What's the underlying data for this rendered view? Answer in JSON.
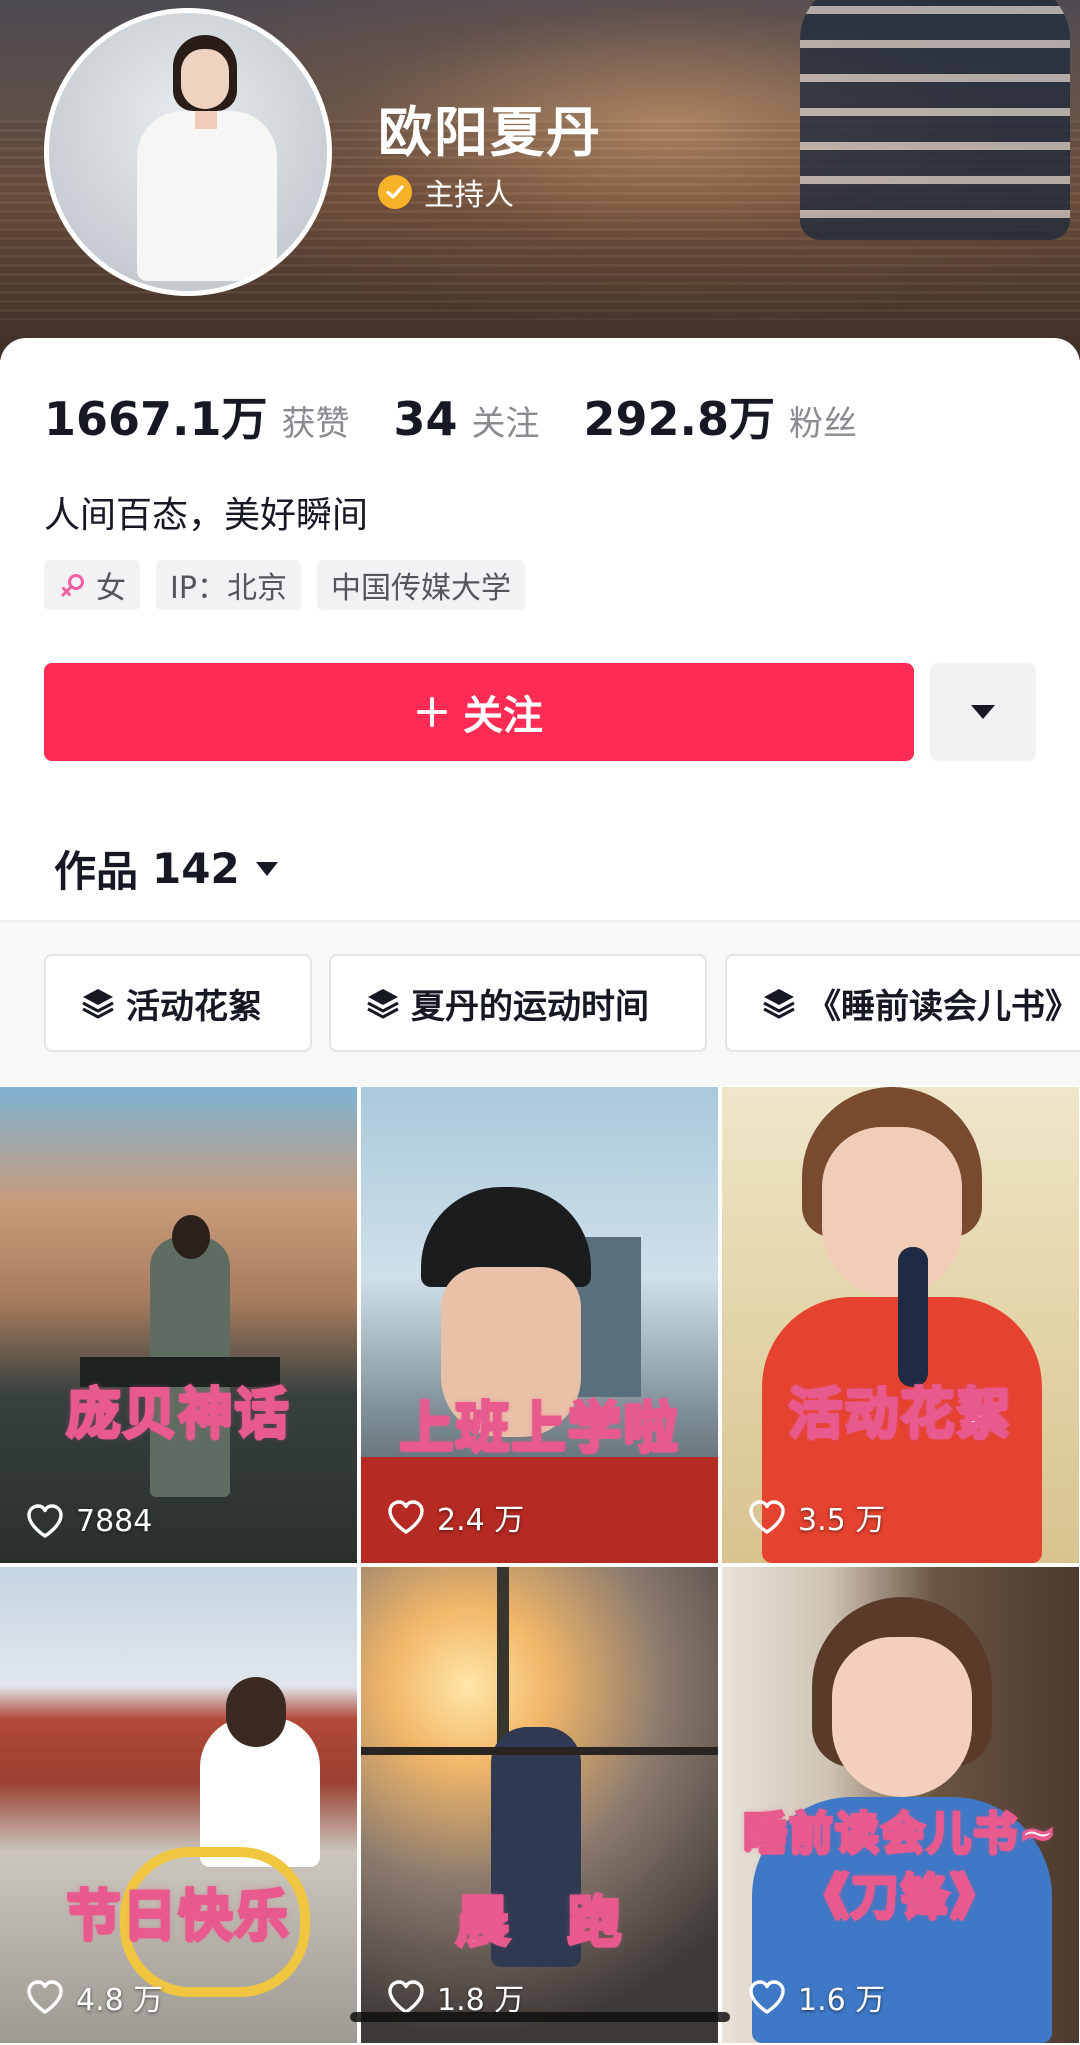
{
  "profile": {
    "name": "欧阳夏丹",
    "verified_label": "主持人",
    "bio": "人间百态，美好瞬间"
  },
  "stats": [
    {
      "value": "1667.1万",
      "label": "获赞"
    },
    {
      "value": "34",
      "label": "关注"
    },
    {
      "value": "292.8万",
      "label": "粉丝"
    }
  ],
  "tags": {
    "gender": "女",
    "ip": "IP：北京",
    "school": "中国传媒大学"
  },
  "actions": {
    "follow_label": "关注"
  },
  "works": {
    "title": "作品",
    "count": "142"
  },
  "collections": [
    {
      "label": "活动花絮"
    },
    {
      "label": "夏丹的运动时间"
    },
    {
      "label": "《睡前读会儿书》"
    }
  ],
  "videos": [
    {
      "caption": "庞贝神话",
      "likes": "7884"
    },
    {
      "caption": "上班上学啦",
      "likes": "2.4 万"
    },
    {
      "caption": "活动花絮",
      "likes": "3.5 万"
    },
    {
      "caption": "节日快乐",
      "likes": "4.8 万"
    },
    {
      "caption": "晨　跑",
      "likes": "1.8 万"
    },
    {
      "caption": "睡前读会儿书~",
      "caption2": "《刀锋》",
      "likes": "1.6 万"
    }
  ],
  "colors": {
    "accent": "#fe2c55",
    "verified": "#f7b228",
    "caption_outline": "#e85a8e"
  }
}
